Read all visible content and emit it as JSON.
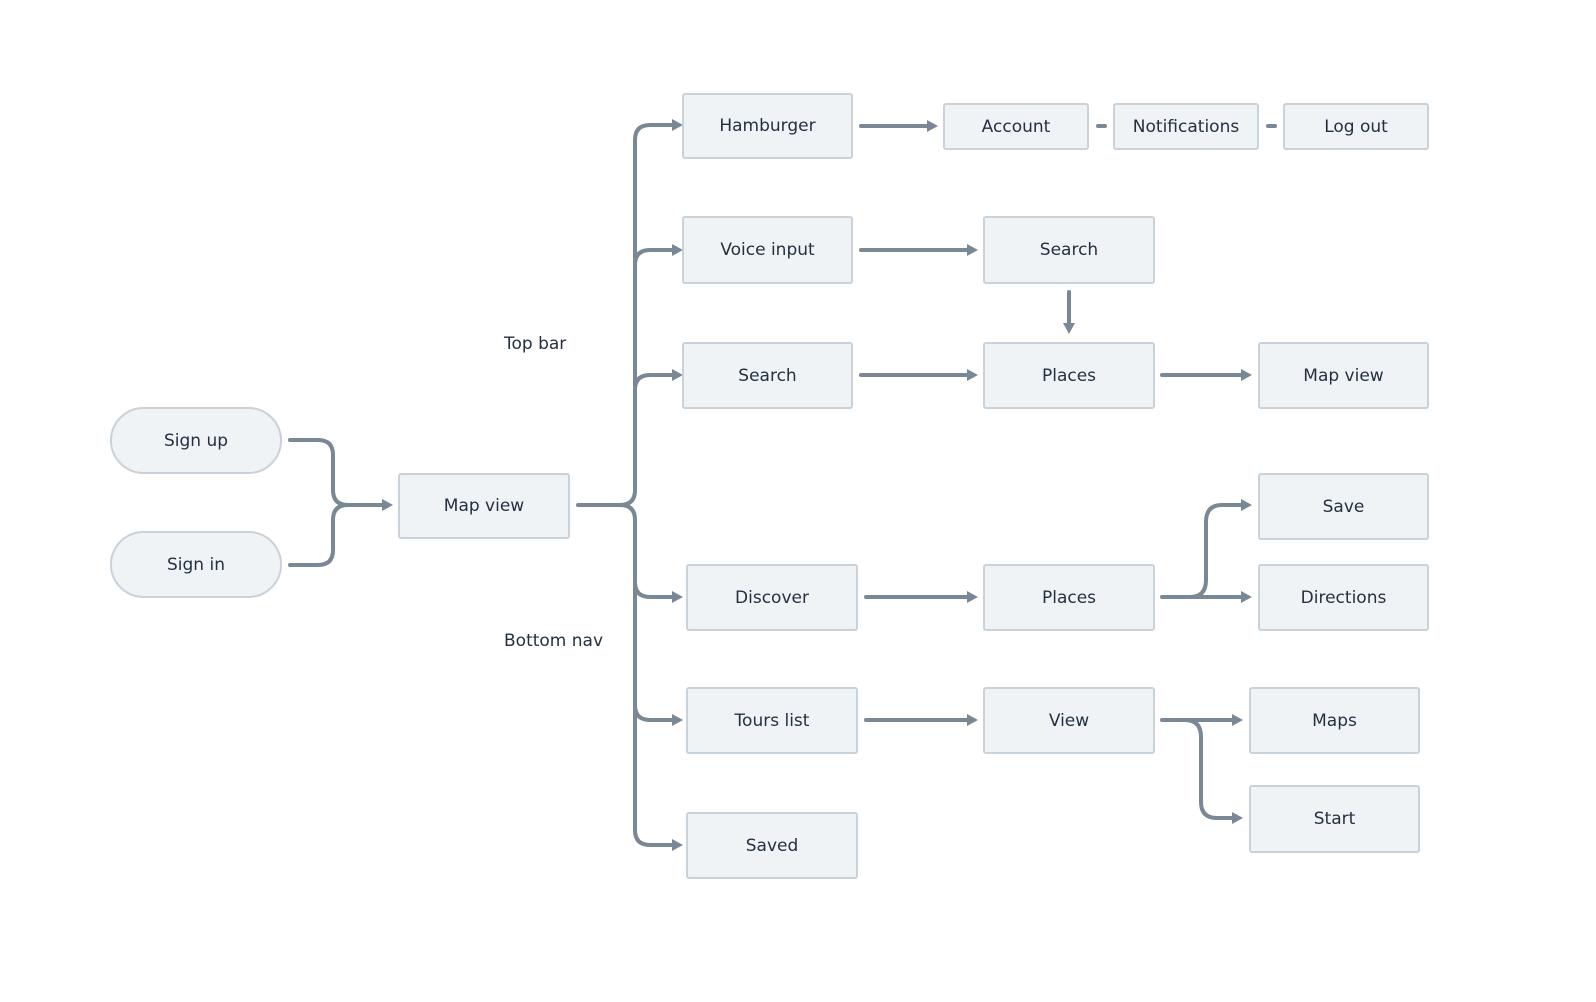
{
  "diagram": {
    "colors": {
      "node_fill": "#f0f3f6",
      "node_border": "#c9d1d9",
      "edge": "#7a8795",
      "text": "#243040"
    },
    "group_labels": {
      "top_bar": "Top bar",
      "bottom_nav": "Bottom nav"
    },
    "nodes": {
      "sign_up": "Sign up",
      "sign_in": "Sign in",
      "map_view_main": "Map view",
      "hamburger": "Hamburger",
      "account": "Account",
      "notifications": "Notifications",
      "log_out": "Log out",
      "voice_input": "Voice input",
      "search_voice": "Search",
      "search": "Search",
      "places_search": "Places",
      "map_view_result": "Map view",
      "discover": "Discover",
      "places_discover": "Places",
      "save": "Save",
      "directions": "Directions",
      "tours_list": "Tours list",
      "view": "View",
      "maps": "Maps",
      "start": "Start",
      "saved": "Saved"
    },
    "edges": [
      [
        "sign_up",
        "map_view_main"
      ],
      [
        "sign_in",
        "map_view_main"
      ],
      [
        "map_view_main",
        "hamburger"
      ],
      [
        "map_view_main",
        "voice_input"
      ],
      [
        "map_view_main",
        "search"
      ],
      [
        "map_view_main",
        "discover"
      ],
      [
        "map_view_main",
        "tours_list"
      ],
      [
        "map_view_main",
        "saved"
      ],
      [
        "hamburger",
        "account"
      ],
      [
        "account",
        "notifications"
      ],
      [
        "notifications",
        "log_out"
      ],
      [
        "voice_input",
        "search_voice"
      ],
      [
        "search_voice",
        "places_search"
      ],
      [
        "search",
        "places_search"
      ],
      [
        "places_search",
        "map_view_result"
      ],
      [
        "discover",
        "places_discover"
      ],
      [
        "places_discover",
        "save"
      ],
      [
        "places_discover",
        "directions"
      ],
      [
        "tours_list",
        "view"
      ],
      [
        "view",
        "maps"
      ],
      [
        "view",
        "start"
      ]
    ]
  }
}
